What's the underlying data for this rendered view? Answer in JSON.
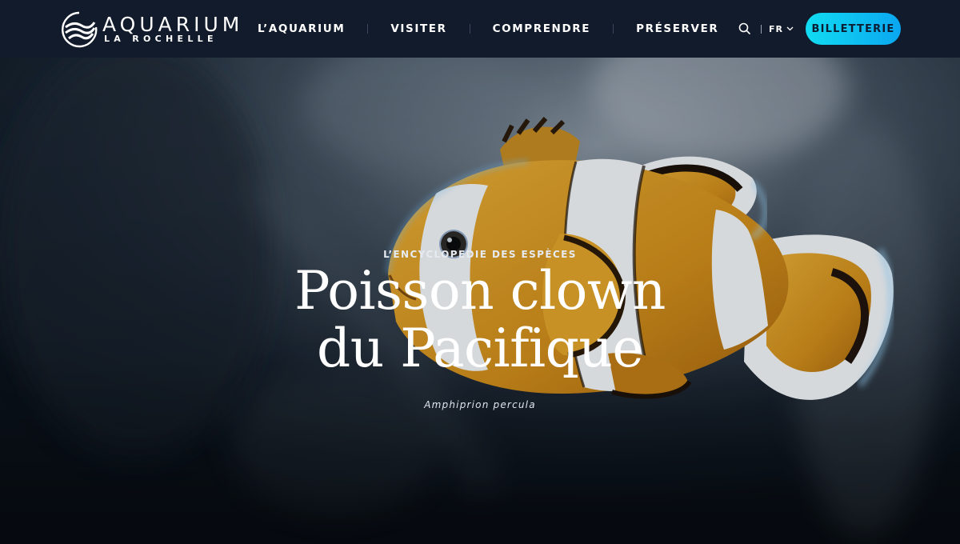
{
  "header": {
    "logo": {
      "title": "AQUARIUM",
      "subtitle": "LA ROCHELLE"
    },
    "nav": [
      {
        "label": "L’AQUARIUM"
      },
      {
        "label": "VISITER"
      },
      {
        "label": "COMPRENDRE"
      },
      {
        "label": "PRÉSERVER"
      }
    ],
    "search_icon": "search-icon",
    "language": {
      "current": "FR",
      "icon": "chevron-down-icon"
    },
    "cta_label": "BILLETTERIE"
  },
  "hero": {
    "eyebrow": "L’ENCYCLOPEDIE DES ESPÈCES",
    "title_line1": "Poisson clown",
    "title_line2": "du Pacifique",
    "scientific_name": "Amphiprion percula",
    "image": "clownfish-photo"
  },
  "colors": {
    "header_bg": "#121b2b",
    "cta_gradient_start": "#11dcf2",
    "cta_gradient_end": "#0aa6f0",
    "hero_bg": "#0c1521",
    "fish_orange": "#d9991e",
    "fish_white": "#f3f5f6"
  }
}
